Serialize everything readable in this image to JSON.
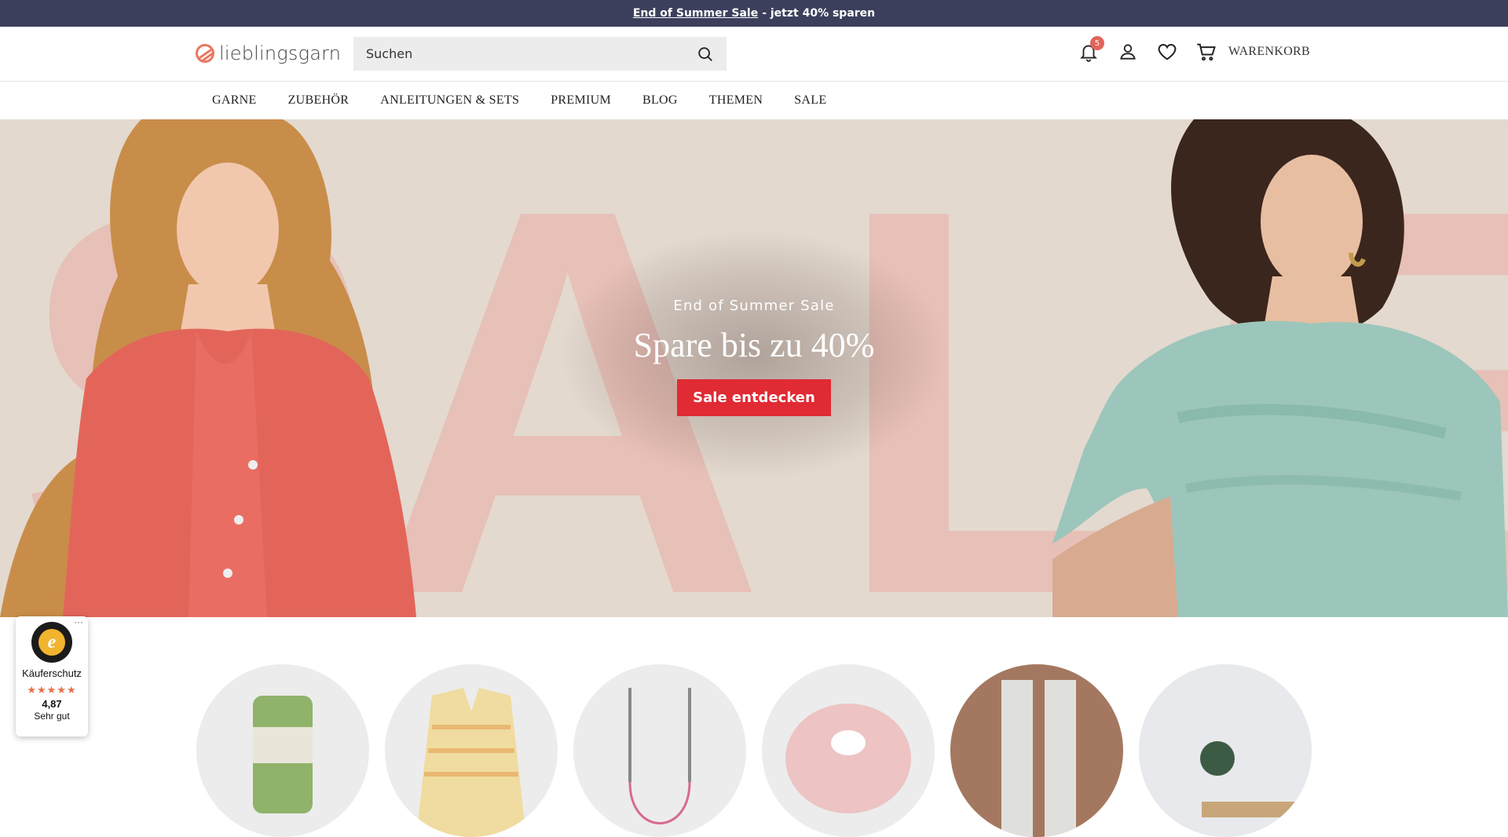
{
  "announcement": {
    "link_text": "End of Summer Sale",
    "text": "- jetzt 40% sparen"
  },
  "header": {
    "logo_text": "lieblingsgarn",
    "search_placeholder": "Suchen",
    "notifications_count": "5",
    "cart_label": "WARENKORB"
  },
  "nav": {
    "items": [
      "GARNE",
      "ZUBEHÖR",
      "ANLEITUNGEN & SETS",
      "PREMIUM",
      "BLOG",
      "THEMEN",
      "SALE"
    ]
  },
  "hero": {
    "eyebrow": "End of Summer Sale",
    "title": "Spare bis zu 40%",
    "button": "Sale entdecken",
    "colors": {
      "button": "#e02a34",
      "background": "#e3d9cf",
      "letters": "#e7c0b7"
    }
  },
  "trust_badge": {
    "label": "Käuferschutz",
    "stars": "★★★★★",
    "score": "4,87",
    "rating_text": "Sehr gut",
    "more": "···"
  },
  "categories": [
    {
      "icon": "yarn-ball"
    },
    {
      "icon": "cardigan"
    },
    {
      "icon": "circular-needles"
    },
    {
      "icon": "macrame-cord"
    },
    {
      "icon": "socks"
    },
    {
      "icon": "yarn-winder"
    }
  ],
  "colors": {
    "announcement_bg": "#3c3f5c",
    "badge": "#e26459"
  }
}
